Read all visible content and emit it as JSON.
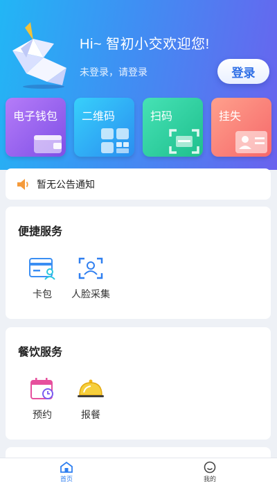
{
  "header": {
    "greeting": "Hi~ 智初小交欢迎您!",
    "subgreeting": "未登录，请登录",
    "login_label": "登录",
    "mascot_icon": "unicorn-origami-icon"
  },
  "tiles": [
    {
      "label": "电子钱包",
      "icon": "wallet-icon",
      "color": "#9b63f0"
    },
    {
      "label": "二维码",
      "icon": "qr-code-icon",
      "color": "#2fa6f3"
    },
    {
      "label": "扫码",
      "icon": "scan-icon",
      "color": "#2ccf9c"
    },
    {
      "label": "挂失",
      "icon": "id-card-icon",
      "color": "#f77f78"
    }
  ],
  "notice": {
    "text": "暂无公告通知",
    "icon": "speaker-icon"
  },
  "quick_services": {
    "title": "便捷服务",
    "items": [
      {
        "label": "卡包",
        "icon": "card-wallet-icon"
      },
      {
        "label": "人脸采集",
        "icon": "face-scan-icon"
      }
    ]
  },
  "dining_services": {
    "title": "餐饮服务",
    "items": [
      {
        "label": "预约",
        "icon": "calendar-clock-icon"
      },
      {
        "label": "报餐",
        "icon": "meal-cloche-icon"
      }
    ]
  },
  "tabbar": {
    "items": [
      {
        "label": "首页",
        "icon": "home-icon",
        "active": true,
        "color": "#2f7ff0"
      },
      {
        "label": "我的",
        "icon": "smiley-icon",
        "active": false,
        "color": "#444444"
      }
    ]
  }
}
